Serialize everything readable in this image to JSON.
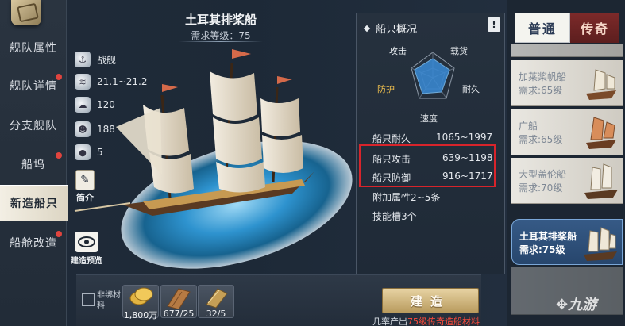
{
  "sidebar": {
    "items": [
      {
        "label": "舰队属性",
        "dot": false
      },
      {
        "label": "舰队详情",
        "dot": true
      },
      {
        "label": "分支舰队",
        "dot": false
      },
      {
        "label": "船坞",
        "dot": true
      },
      {
        "label": "新造船只",
        "dot": false,
        "active": true
      },
      {
        "label": "船舱改造",
        "dot": true
      }
    ]
  },
  "ship": {
    "name": "土耳其排桨船",
    "level_req": "需求等级：75",
    "stats": {
      "type": "战舰",
      "speed": "21.1~21.2",
      "capacity": "120",
      "crew": "188",
      "cannons": "5"
    },
    "intro_label": "简介",
    "preview_label": "建造预览"
  },
  "materials": {
    "unbound_label": "非绑材料",
    "items": [
      {
        "icon": "gold-coins-icon",
        "count": "1,800万"
      },
      {
        "icon": "wood-plank-icon",
        "count": "677/25"
      },
      {
        "icon": "sail-cloth-icon",
        "count": "32/5"
      }
    ],
    "build_label": "建造",
    "rate_prefix": "几率产出",
    "rate_highlight": "75级传奇造船材料"
  },
  "overview": {
    "title": "船只概况",
    "alert": "!",
    "radar": {
      "attack": "攻击",
      "cargo": "载货",
      "defense": "防护",
      "durability": "耐久",
      "speed": "速度"
    },
    "rows": [
      {
        "label": "船只耐久",
        "value": "1065~1997"
      },
      {
        "label": "船只攻击",
        "value": "639~1198"
      },
      {
        "label": "船只防御",
        "value": "916~1717"
      }
    ],
    "extra_attr": "附加属性2~5条",
    "skill_slots": "技能槽3个"
  },
  "list": {
    "tabs": {
      "normal": "普通",
      "legend": "传奇"
    },
    "items": [
      {
        "name": "加莱桨帆船",
        "req": "需求:65级"
      },
      {
        "name": "广船",
        "req": "需求:65级"
      },
      {
        "name": "大型盖伦船",
        "req": "需求:70级"
      },
      {
        "name": "土耳其排桨船",
        "req": "需求:75级",
        "selected": true
      }
    ]
  },
  "watermark": "九游",
  "colors": {
    "highlight_box": "#d8242b",
    "radar_fill": "#3a8bd6",
    "selected_item": "#2f5180",
    "legend_tab": "#6e2424"
  }
}
